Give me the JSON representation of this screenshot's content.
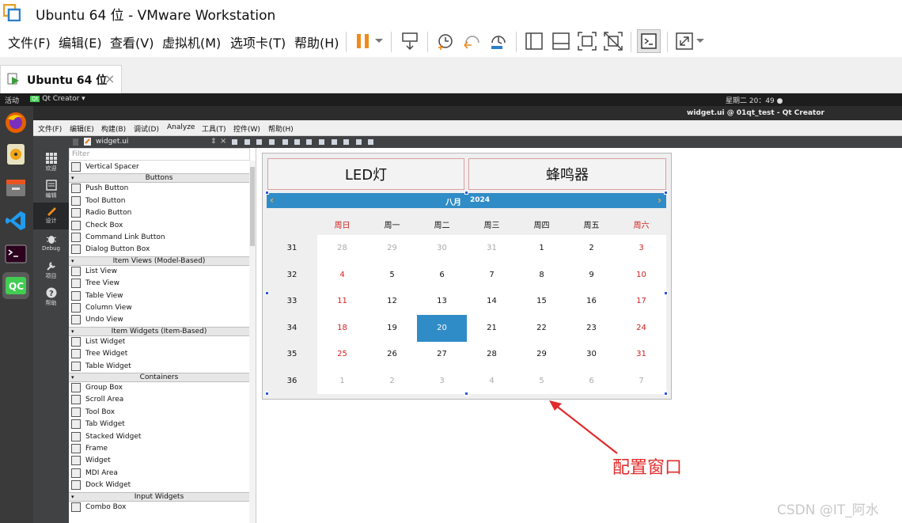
{
  "window": {
    "title": "Ubuntu 64 位 - VMware Workstation"
  },
  "vmware": {
    "menus": [
      "文件(F)",
      "编辑(E)",
      "查看(V)",
      "虚拟机(M)",
      "选项卡(T)",
      "帮助(H)"
    ],
    "toolbar_icons": [
      "pause-icon",
      "dropdown-icon",
      "send-ctrl-alt-del-icon",
      "snapshot-icon",
      "revert-snapshot-icon",
      "snapshot-manager-icon",
      "fullscreen-console-icon",
      "quick-switch-icon",
      "stretch-icon",
      "unity-icon",
      "terminal-icon",
      "fit-window-icon",
      "dropdown-icon"
    ],
    "tab": {
      "label": "Ubuntu 64 位",
      "close": "×"
    }
  },
  "ubuntu": {
    "activities": "活动",
    "app_menu": "Qt Creator ▾",
    "clock": "星期二 20：49 ●",
    "window_title": "widget.ui @ 01qt_test - Qt Creator",
    "dock": [
      "firefox-icon",
      "rhythmbox-icon",
      "files-icon",
      "vscode-icon",
      "terminal-icon",
      "qtcreator-icon"
    ]
  },
  "qt": {
    "menus": [
      "文件(F)",
      "编辑(E)",
      "构建(B)",
      "调试(D)",
      "Analyze",
      "工具(T)",
      "控件(W)",
      "帮助(H)"
    ],
    "modes": [
      {
        "label": "欢迎",
        "icon": "grid-icon"
      },
      {
        "label": "编辑",
        "icon": "edit-icon"
      },
      {
        "label": "设计",
        "icon": "pen-icon"
      },
      {
        "label": "Debug",
        "icon": "bug-icon"
      },
      {
        "label": "项目",
        "icon": "wrench-icon"
      },
      {
        "label": "帮助",
        "icon": "help-icon"
      }
    ],
    "file_tab": "widget.ui",
    "file_tab_arrows": "⇕",
    "filter_placeholder": "Filter",
    "widget_box": [
      {
        "type": "item",
        "label": "Vertical Spacer"
      },
      {
        "type": "cat",
        "label": "Buttons"
      },
      {
        "type": "item",
        "label": "Push Button"
      },
      {
        "type": "item",
        "label": "Tool Button"
      },
      {
        "type": "item",
        "label": "Radio Button"
      },
      {
        "type": "item",
        "label": "Check Box"
      },
      {
        "type": "item",
        "label": "Command Link Button"
      },
      {
        "type": "item",
        "label": "Dialog Button Box"
      },
      {
        "type": "cat",
        "label": "Item Views (Model-Based)"
      },
      {
        "type": "item",
        "label": "List View"
      },
      {
        "type": "item",
        "label": "Tree View"
      },
      {
        "type": "item",
        "label": "Table View"
      },
      {
        "type": "item",
        "label": "Column View"
      },
      {
        "type": "item",
        "label": "Undo View"
      },
      {
        "type": "cat",
        "label": "Item Widgets (Item-Based)"
      },
      {
        "type": "item",
        "label": "List Widget"
      },
      {
        "type": "item",
        "label": "Tree Widget"
      },
      {
        "type": "item",
        "label": "Table Widget"
      },
      {
        "type": "cat",
        "label": "Containers"
      },
      {
        "type": "item",
        "label": "Group Box"
      },
      {
        "type": "item",
        "label": "Scroll Area"
      },
      {
        "type": "item",
        "label": "Tool Box"
      },
      {
        "type": "item",
        "label": "Tab Widget"
      },
      {
        "type": "item",
        "label": "Stacked Widget"
      },
      {
        "type": "item",
        "label": "Frame"
      },
      {
        "type": "item",
        "label": "Widget"
      },
      {
        "type": "item",
        "label": "MDI Area"
      },
      {
        "type": "item",
        "label": "Dock Widget"
      },
      {
        "type": "cat",
        "label": "Input Widgets"
      },
      {
        "type": "item",
        "label": "Combo Box"
      }
    ]
  },
  "form": {
    "buttons": [
      "LED灯",
      "蜂鸣器"
    ],
    "calendar": {
      "month": "八月",
      "year": "2024",
      "prev": "‹",
      "next": "›",
      "headers": [
        "周日",
        "周一",
        "周二",
        "周三",
        "周四",
        "周五",
        "周六"
      ],
      "weeks": [
        "31",
        "32",
        "33",
        "34",
        "35",
        "36"
      ],
      "days": [
        [
          "28",
          "29",
          "30",
          "31",
          "1",
          "2",
          "3"
        ],
        [
          "4",
          "5",
          "6",
          "7",
          "8",
          "9",
          "10"
        ],
        [
          "11",
          "12",
          "13",
          "14",
          "15",
          "16",
          "17"
        ],
        [
          "18",
          "19",
          "20",
          "21",
          "22",
          "23",
          "24"
        ],
        [
          "25",
          "26",
          "27",
          "28",
          "29",
          "30",
          "31"
        ],
        [
          "1",
          "2",
          "3",
          "4",
          "5",
          "6",
          "7"
        ]
      ],
      "selected": "20",
      "accent": "#308cc6",
      "weekend_color": "#d42020"
    }
  },
  "annotation": "配置窗口",
  "watermark": "CSDN @IT_阿水"
}
